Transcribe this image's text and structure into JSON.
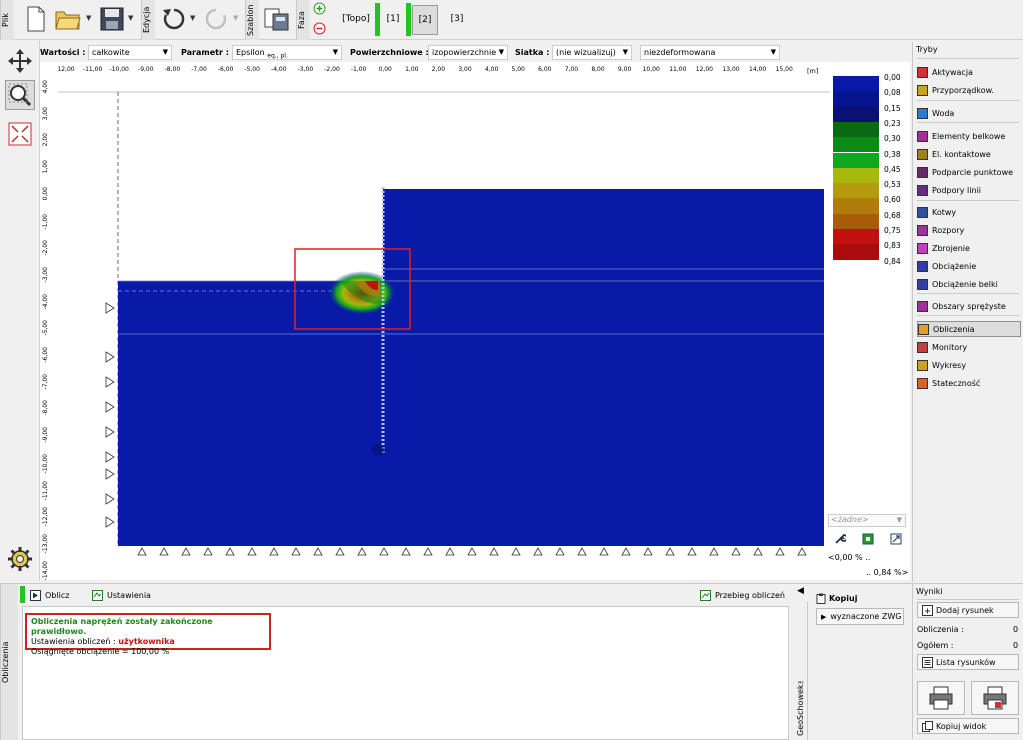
{
  "toolbar": {
    "file_label": "Plik",
    "edit_label": "Edycja",
    "template_label": "Szablon",
    "phase_label": "Faza",
    "phases": [
      "[Topo]",
      "[1]",
      "[2]",
      "[3]"
    ],
    "active_phase": "[2]"
  },
  "filters": {
    "values_label": "Wartości :",
    "values_value": "całkowite",
    "param_label": "Parametr :",
    "param_value": "Epsilon",
    "param_sub": "eq., pl.",
    "surface_label": "Powierzchniowe :",
    "surface_value": "izopowierzchnie",
    "mesh_label": "Siatka :",
    "mesh_value": "(nie wizualizuj)",
    "deform_value": "niezdeformowana"
  },
  "ruler": {
    "top_labels": [
      "12,00",
      "-11,00",
      "-10,00",
      "-9,00",
      "-8,00",
      "-7,00",
      "-6,00",
      "-5,00",
      "-4,00",
      "-3,00",
      "-2,00",
      "-1,00",
      "0,00",
      "1,00",
      "2,00",
      "3,00",
      "4,00",
      "5,00",
      "6,00",
      "7,00",
      "8,00",
      "9,00",
      "10,00",
      "11,00",
      "12,00",
      "13,00",
      "14,00",
      "15,00"
    ],
    "unit": "[m]",
    "left_labels": [
      "4,00",
      "3,00",
      "2,00",
      "1,00",
      "0,00",
      "-1,00",
      "-2,00",
      "-3,00",
      "-4,00",
      "-5,00",
      "-6,00",
      "-7,00",
      "-8,00",
      "-9,00",
      "-10,00",
      "-11,00",
      "-12,00",
      "-13,00",
      "-14,00"
    ]
  },
  "legend": {
    "values": [
      "0,00",
      "0,08",
      "0,15",
      "0,23",
      "0,30",
      "0,38",
      "0,45",
      "0,53",
      "0,60",
      "0,68",
      "0,75",
      "0,83",
      "0,84"
    ],
    "colors": [
      "#0a1aa8",
      "#071490",
      "#081270",
      "#0a6a14",
      "#0d8a16",
      "#11a81e",
      "#a6b80e",
      "#b49a0c",
      "#b07c0a",
      "#a85c08",
      "#c01010",
      "#a80c0c",
      "#8c0808"
    ],
    "selector": "<żadne>",
    "min_label": "<0,00 % ..",
    "max_label": ".. 0,84 %>"
  },
  "modes": {
    "title": "Tryby",
    "items": [
      {
        "label": "Aktywacja",
        "icon": "activation-icon"
      },
      {
        "label": "Przyporządkow.",
        "icon": "assign-icon"
      },
      {
        "label": "Woda",
        "icon": "water-icon"
      },
      {
        "label": "Elementy belkowe",
        "icon": "beam-icon"
      },
      {
        "label": "El. kontaktowe",
        "icon": "contact-icon"
      },
      {
        "label": "Podparcie punktowe",
        "icon": "point-support-icon"
      },
      {
        "label": "Podpory linii",
        "icon": "line-support-icon"
      },
      {
        "label": "Kotwy",
        "icon": "anchor-icon"
      },
      {
        "label": "Rozpory",
        "icon": "strut-icon"
      },
      {
        "label": "Zbrojenie",
        "icon": "reinforcement-icon"
      },
      {
        "label": "Obciążenie",
        "icon": "load-icon"
      },
      {
        "label": "Obciążenie belki",
        "icon": "beam-load-icon"
      },
      {
        "label": "Obszary sprężyste",
        "icon": "elastic-icon"
      },
      {
        "label": "Obliczenia",
        "icon": "calculation-icon"
      },
      {
        "label": "Monitory",
        "icon": "monitor-icon"
      },
      {
        "label": "Wykresy",
        "icon": "chart-icon"
      },
      {
        "label": "Stateczność",
        "icon": "stability-icon"
      }
    ],
    "active": "Obliczenia"
  },
  "bottom": {
    "side_label": "Obliczenia",
    "compute_label": "Oblicz",
    "settings_label": "Ustawienia",
    "progress_label": "Przebieg obliczeń",
    "msg_title": "Obliczenia naprężeń zostały zakończone prawidłowo.",
    "msg_settings_prefix": "Ustawienia obliczeń : ",
    "msg_settings_value": "użytkownika",
    "msg_load": "Osiągnięte obciążenie = 100,00 %",
    "clip_title": "Kopiuj",
    "clip_item": "wyznaczone ZWG",
    "geoschowek": "GeoSchowek™"
  },
  "results": {
    "title": "Wyniki",
    "add_drawing": "Dodaj rysunek",
    "calc_label": "Obliczenia :",
    "calc_value": "0",
    "total_label": "Ogółem :",
    "total_value": "0",
    "list_drawings": "Lista rysunków",
    "copy_view": "Kopiuj widok"
  }
}
